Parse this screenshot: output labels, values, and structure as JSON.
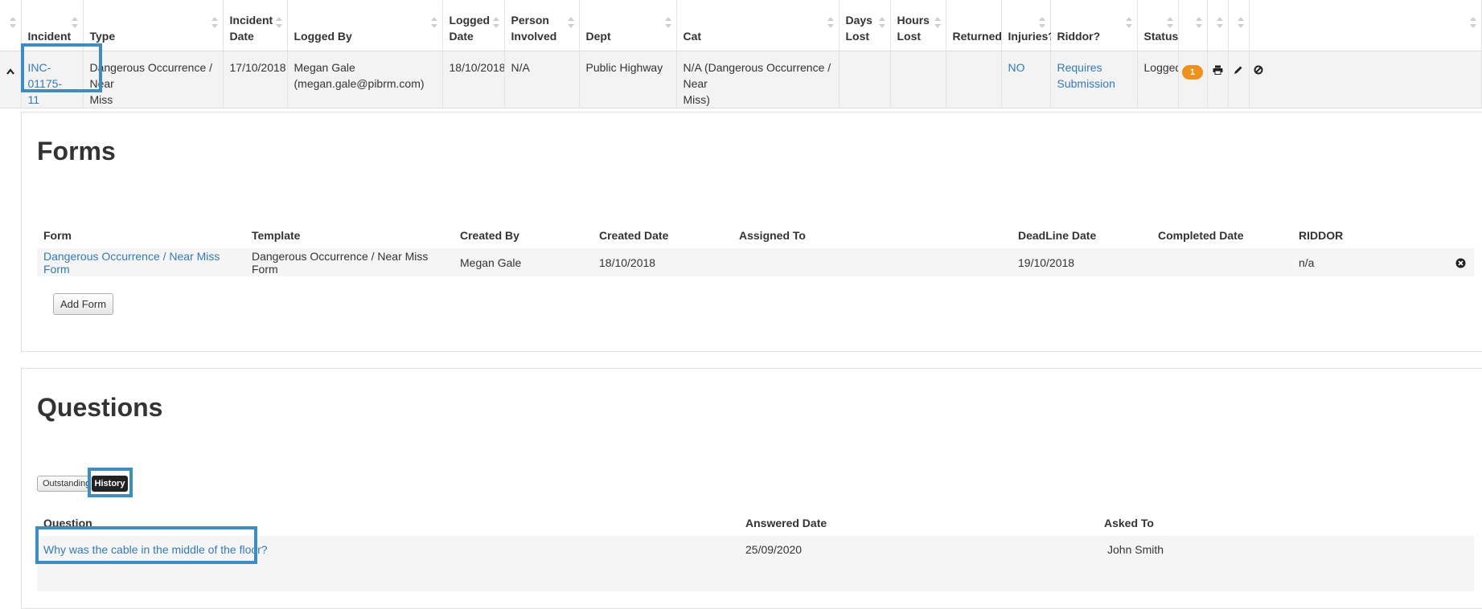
{
  "incident_table": {
    "headers": [
      "Incident",
      "Type",
      "Incident Date",
      "Logged By",
      "Logged Date",
      "Person Involved",
      "Dept",
      "Cat",
      "Days Lost",
      "Hours Lost",
      "Returned",
      "Injuries?",
      "Riddor?",
      "Status"
    ],
    "headers_display": {
      "incident_date": [
        "Incident",
        "Date"
      ],
      "logged_date": [
        "Logged",
        "Date"
      ],
      "person_involved": [
        "Person",
        "Involved"
      ],
      "days_lost": [
        "Days",
        "Lost"
      ],
      "hours_lost": [
        "Hours",
        "Lost"
      ]
    },
    "row": {
      "incident": [
        "INC-01175-",
        "11"
      ],
      "type": [
        "Dangerous Occurrence / Near",
        "Miss"
      ],
      "incident_date": "17/10/2018",
      "logged_by": [
        "Megan Gale",
        "(megan.gale@pibrm.com)"
      ],
      "logged_date": "18/10/2018",
      "person_involved": "N/A",
      "dept": "Public Highway",
      "cat": [
        "N/A (Dangerous Occurrence / Near",
        "Miss)"
      ],
      "days_lost": "",
      "hours_lost": "",
      "returned": "",
      "injuries": "NO",
      "riddor": [
        "Requires",
        "Submission"
      ],
      "status": "Logged",
      "badge": "1"
    },
    "icons": [
      "chevron-up-icon",
      "print-icon",
      "pencil-icon",
      "cancel-icon"
    ]
  },
  "forms": {
    "title": "Forms",
    "headers": [
      "Form",
      "Template",
      "Created By",
      "Created Date",
      "Assigned To",
      "DeadLine Date",
      "Completed Date",
      "RIDDOR"
    ],
    "rows": [
      {
        "form": "Dangerous Occurrence / Near Miss Form",
        "template": "Dangerous Occurrence / Near Miss Form",
        "created_by": "Megan Gale",
        "created_date": "18/10/2018",
        "assigned_to": "",
        "deadline_date": "19/10/2018",
        "completed_date": "",
        "riddor": "n/a"
      }
    ],
    "add_button": "Add Form"
  },
  "questions": {
    "title": "Questions",
    "tabs": [
      "Outstanding",
      "History"
    ],
    "active_tab": "History",
    "headers": [
      "Question",
      "Answered Date",
      "Asked To"
    ],
    "rows": [
      {
        "question": "Why was the cable in the middle of the floor?",
        "answered_date": "25/09/2020",
        "asked_to": "John Smith"
      }
    ]
  },
  "colors": {
    "link": "#337ab7",
    "highlight": "#3d8dc0",
    "badge": "#f0901e",
    "row_bg": "#f3f3f3"
  }
}
